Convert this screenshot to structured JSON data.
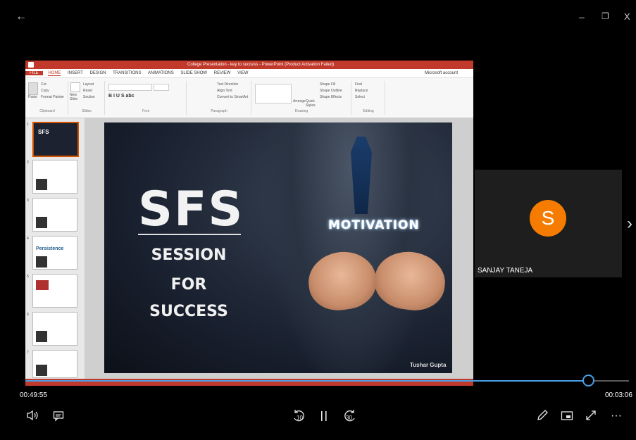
{
  "window": {
    "back_icon": "back-arrow-icon",
    "minimize": "–",
    "restore": "❐",
    "close": "X"
  },
  "ppt": {
    "title": "College Presentation - key to success - PowerPoint (Product Activation Failed)",
    "tabs": [
      "FILE",
      "HOME",
      "INSERT",
      "DESIGN",
      "TRANSITIONS",
      "ANIMATIONS",
      "SLIDE SHOW",
      "REVIEW",
      "VIEW"
    ],
    "account": "Microsoft account",
    "ribbon_groups": [
      "Clipboard",
      "Slides",
      "Font",
      "Paragraph",
      "Drawing",
      "Editing"
    ],
    "clipboard_items": [
      "Cut",
      "Copy",
      "Format Painter"
    ],
    "slides_items": [
      "Layout",
      "Reset",
      "Section"
    ],
    "new_slide": "New Slide",
    "paste": "Paste",
    "paragraph_items": [
      "Text Direction",
      "Align Text",
      "Convert to SmartArt"
    ],
    "drawing_items": [
      "Arrange",
      "Quick Styles",
      "Shape Fill",
      "Shape Outline",
      "Shape Effects"
    ],
    "editing_items": [
      "Find",
      "Replace",
      "Select"
    ],
    "thumb_numbers": [
      "1",
      "2",
      "3",
      "4",
      "5",
      "6",
      "7"
    ],
    "thumb_persistence": "Persistence"
  },
  "slide": {
    "big_title": "SFS",
    "line1": "SESSION",
    "line2": "FOR",
    "line3": "SUCCESS",
    "motivation": "MOTIVATION",
    "author": "Tushar Gupta"
  },
  "participant": {
    "initial": "S",
    "name": "SANJAY TANEJA",
    "avatar_color": "#f57c00"
  },
  "player": {
    "elapsed": "00:49:55",
    "remaining": "00:03:06",
    "progress_fraction": 0.932,
    "skip_back": "10",
    "skip_forward": "30",
    "more": "···"
  }
}
